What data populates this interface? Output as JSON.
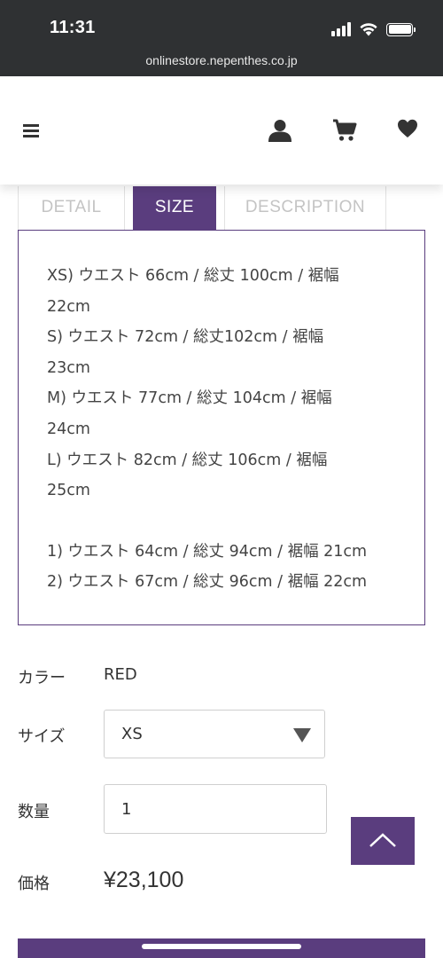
{
  "status_bar": {
    "time": "11:31"
  },
  "browser": {
    "url": "onlinestore.nepenthes.co.jp"
  },
  "header": {
    "icons": [
      "menu-icon",
      "user-icon",
      "cart-icon",
      "heart-icon"
    ]
  },
  "tabs": [
    {
      "label": "DETAIL",
      "active": false
    },
    {
      "label": "SIZE",
      "active": true
    },
    {
      "label": "DESCRIPTION",
      "active": false
    }
  ],
  "size_info": {
    "lines_a": [
      "XS) ウエスト 66cm / 総丈 100cm / 裾幅",
      "22cm",
      "S) ウエスト 72cm / 総丈102cm / 裾幅",
      "23cm",
      "M) ウエスト 77cm / 総丈 104cm / 裾幅",
      "24cm",
      "L) ウエスト 82cm / 総丈 106cm / 裾幅",
      "25cm"
    ],
    "lines_b": [
      "1) ウエスト 64cm / 総丈 94cm / 裾幅 21cm",
      "2) ウエスト 67cm / 総丈 96cm / 裾幅 22cm"
    ]
  },
  "form": {
    "color_label": "カラー",
    "color_value": "RED",
    "size_label": "サイズ",
    "size_value": "XS",
    "qty_label": "数量",
    "qty_value": "1",
    "price_label": "価格",
    "price_value": "¥23,100"
  },
  "colors": {
    "accent": "#5a3d7e",
    "statusbar": "#2f3133"
  }
}
